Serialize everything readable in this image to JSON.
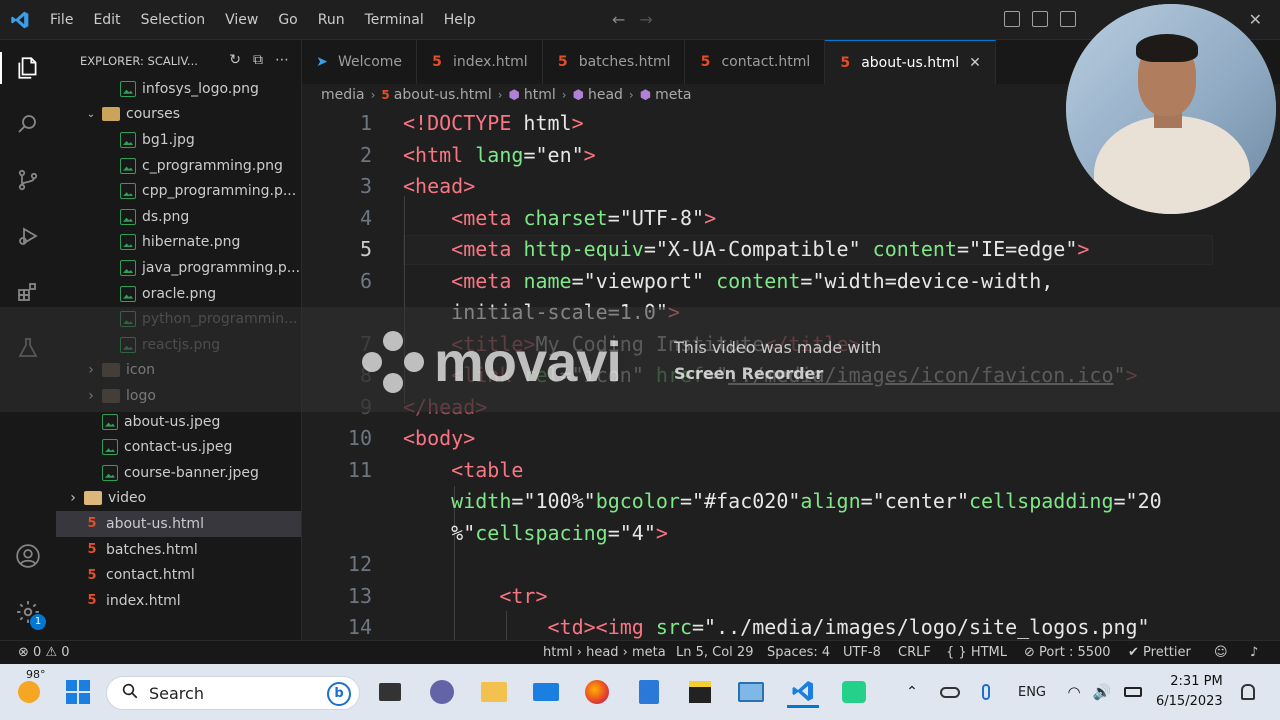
{
  "menu": [
    "File",
    "Edit",
    "Selection",
    "View",
    "Go",
    "Run",
    "Terminal",
    "Help"
  ],
  "explorer": {
    "title": "EXPLORER: SCALIV...",
    "items": [
      {
        "label": "infosys_logo.png",
        "type": "img",
        "indent": 3
      },
      {
        "label": "courses",
        "type": "folder-open",
        "indent": 2
      },
      {
        "label": "bg1.jpg",
        "type": "img",
        "indent": 3
      },
      {
        "label": "c_programming.png",
        "type": "img",
        "indent": 3
      },
      {
        "label": "cpp_programming.p...",
        "type": "img",
        "indent": 3
      },
      {
        "label": "ds.png",
        "type": "img",
        "indent": 3
      },
      {
        "label": "hibernate.png",
        "type": "img",
        "indent": 3
      },
      {
        "label": "java_programming.p...",
        "type": "img",
        "indent": 3
      },
      {
        "label": "oracle.png",
        "type": "img",
        "indent": 3
      },
      {
        "label": "python_programmin...",
        "type": "img",
        "indent": 3
      },
      {
        "label": "reactjs.png",
        "type": "img",
        "indent": 3
      },
      {
        "label": "icon",
        "type": "folder",
        "indent": 2
      },
      {
        "label": "logo",
        "type": "folder",
        "indent": 2
      },
      {
        "label": "about-us.jpeg",
        "type": "img",
        "indent": 2
      },
      {
        "label": "contact-us.jpeg",
        "type": "img",
        "indent": 2
      },
      {
        "label": "course-banner.jpeg",
        "type": "img",
        "indent": 2
      },
      {
        "label": "video",
        "type": "folder",
        "indent": 1
      },
      {
        "label": "about-us.html",
        "type": "html",
        "indent": 1,
        "selected": true
      },
      {
        "label": "batches.html",
        "type": "html",
        "indent": 1
      },
      {
        "label": "contact.html",
        "type": "html",
        "indent": 1
      },
      {
        "label": "index.html",
        "type": "html",
        "indent": 1
      }
    ]
  },
  "tabs": [
    {
      "label": "Welcome",
      "icon": "vscode-icon"
    },
    {
      "label": "index.html",
      "icon": "html-icon"
    },
    {
      "label": "batches.html",
      "icon": "html-icon"
    },
    {
      "label": "contact.html",
      "icon": "html-icon"
    },
    {
      "label": "about-us.html",
      "icon": "html-icon",
      "active": true
    }
  ],
  "breadcrumb": [
    "media",
    "about-us.html",
    "html",
    "head",
    "meta"
  ],
  "editor": {
    "line_numbers": [
      "1",
      "2",
      "3",
      "4",
      "5",
      "6",
      "7",
      "8",
      "9",
      "10",
      "11",
      "12",
      "13",
      "14"
    ],
    "current_line": "5"
  },
  "watermark": {
    "brand": "movavi",
    "note1": "This video was made with",
    "note2": "Screen Recorder"
  },
  "status": {
    "problems": "0",
    "warnings": "0",
    "path": "html › head › meta",
    "position": "Ln 5, Col 29",
    "spaces": "Spaces: 4",
    "encoding": "UTF-8",
    "eol": "CRLF",
    "language": "HTML",
    "port": "Port : 5500",
    "formatter": "Prettier"
  },
  "taskbar": {
    "temperature": "98°",
    "search_placeholder": "Search",
    "language": "ENG",
    "time": "2:31 PM",
    "date": "6/15/2023"
  },
  "accounts_badge": "1",
  "colors": {
    "accent": "#0078d4",
    "tag": "#f97583",
    "attr": "#7ee787",
    "html_icon": "#e44d26",
    "image_icon": "#2f9e5a"
  }
}
